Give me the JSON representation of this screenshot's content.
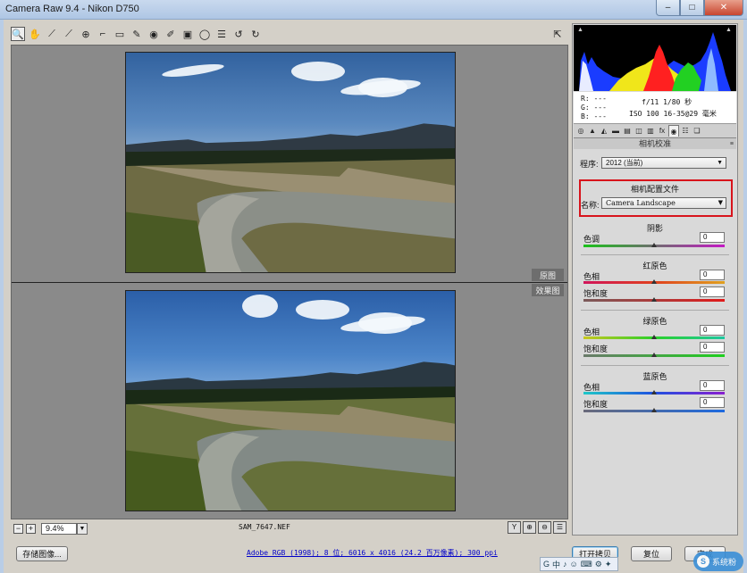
{
  "window": {
    "title": "Camera Raw 9.4 -  Nikon D750",
    "min_glyph": "–",
    "max_glyph": "□",
    "close_glyph": "✕"
  },
  "toolbar": {
    "tools": [
      {
        "icon": "zoom-tool-icon",
        "glyph": "🔍",
        "active": true
      },
      {
        "icon": "hand-tool-icon",
        "glyph": "✋"
      },
      {
        "icon": "white-balance-tool-icon",
        "glyph": "⟋"
      },
      {
        "icon": "color-sampler-tool-icon",
        "glyph": "⟋"
      },
      {
        "icon": "targeted-adjustment-tool-icon",
        "glyph": "⊕"
      },
      {
        "icon": "crop-tool-icon",
        "glyph": "⌐"
      },
      {
        "icon": "straighten-tool-icon",
        "glyph": "▭"
      },
      {
        "icon": "spot-removal-tool-icon",
        "glyph": "✎"
      },
      {
        "icon": "red-eye-tool-icon",
        "glyph": "◉"
      },
      {
        "icon": "adjustment-brush-icon",
        "glyph": "✐"
      },
      {
        "icon": "graduated-filter-icon",
        "glyph": "▣"
      },
      {
        "icon": "radial-filter-icon",
        "glyph": "◯"
      },
      {
        "icon": "preferences-icon",
        "glyph": "☰"
      },
      {
        "icon": "rotate-left-icon",
        "glyph": "↺"
      },
      {
        "icon": "rotate-right-icon",
        "glyph": "↻"
      }
    ],
    "fullscreen_glyph": "⇱"
  },
  "preview": {
    "before_tag": "原图",
    "after_tag": "效果图",
    "zoom_out": "−",
    "zoom_in": "+",
    "zoom_value": "9.4%",
    "filename": "SAM_7647.NEF",
    "view_modes": [
      "Y",
      "⊕",
      "⊖",
      "☰"
    ]
  },
  "footer": {
    "save_label": "存储图像...",
    "workflow_text": "Adobe RGB (1998); 8 位; 6016 x 4016 (24.2 百万像素); 300 ppi",
    "open_label": "打开拷贝",
    "reset_label": "复位",
    "done_label": "完成"
  },
  "ime": {
    "items": [
      "G",
      "中",
      "♪",
      "☺",
      "⌨",
      "⚙",
      "✦"
    ]
  },
  "watermark": {
    "logo": "S",
    "text": "系统粉"
  },
  "panel": {
    "exif": {
      "r": "R:  ---",
      "g": "G:  ---",
      "b": "B:  ---",
      "line1": "f/11   1/80 秒",
      "line2": "ISO 100   16-35@29 毫米"
    },
    "tabs": [
      "◎",
      "▲",
      "◭",
      "▬",
      "▤",
      "◫",
      "▥",
      "fx",
      "◉",
      "☷",
      "❏"
    ],
    "active_tab": 8,
    "section_title": "相机校准",
    "section_menu": "≡",
    "process_label": "程序:",
    "process_value": "2012 (当前)",
    "profile_title": "相机配置文件",
    "name_label": "名称:",
    "name_value": "Camera Landscape",
    "shadows": {
      "title": "阴影",
      "tint_label": "色调",
      "tint_value": "0"
    },
    "red": {
      "title": "红原色",
      "hue_label": "色相",
      "hue_value": "0",
      "sat_label": "饱和度",
      "sat_value": "0"
    },
    "green": {
      "title": "绿原色",
      "hue_label": "色相",
      "hue_value": "0",
      "sat_label": "饱和度",
      "sat_value": "0"
    },
    "blue": {
      "title": "蓝原色",
      "hue_label": "色相",
      "hue_value": "0",
      "sat_label": "饱和度",
      "sat_value": "0"
    }
  },
  "colors": {
    "highlight_border": "#d8141c",
    "link": "#0000c8"
  }
}
